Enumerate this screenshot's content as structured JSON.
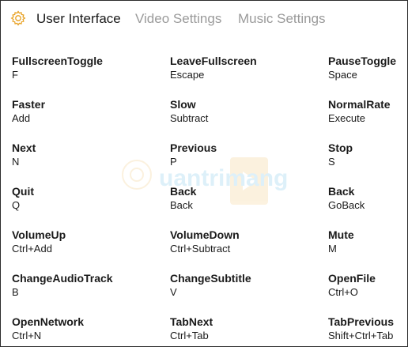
{
  "tabs": [
    {
      "label": "User Interface",
      "active": true
    },
    {
      "label": "Video Settings",
      "active": false
    },
    {
      "label": "Music Settings",
      "active": false
    }
  ],
  "colors": {
    "accent": "#e8a020",
    "text": "#1a1a1a",
    "inactive_tab": "#9a9a9a"
  },
  "icons": {
    "settings": "gear-icon"
  },
  "shortcuts": [
    [
      {
        "name": "FullscreenToggle",
        "key": "F"
      },
      {
        "name": "LeaveFullscreen",
        "key": "Escape"
      },
      {
        "name": "PauseToggle",
        "key": "Space"
      }
    ],
    [
      {
        "name": "Faster",
        "key": "Add"
      },
      {
        "name": "Slow",
        "key": "Subtract"
      },
      {
        "name": "NormalRate",
        "key": "Execute"
      }
    ],
    [
      {
        "name": "Next",
        "key": "N"
      },
      {
        "name": "Previous",
        "key": "P"
      },
      {
        "name": "Stop",
        "key": "S"
      }
    ],
    [
      {
        "name": "Quit",
        "key": "Q"
      },
      {
        "name": "Back",
        "key": "Back"
      },
      {
        "name": "Back",
        "key": "GoBack"
      }
    ],
    [
      {
        "name": "VolumeUp",
        "key": "Ctrl+Add"
      },
      {
        "name": "VolumeDown",
        "key": "Ctrl+Subtract"
      },
      {
        "name": "Mute",
        "key": "M"
      }
    ],
    [
      {
        "name": "ChangeAudioTrack",
        "key": "B"
      },
      {
        "name": "ChangeSubtitle",
        "key": "V"
      },
      {
        "name": "OpenFile",
        "key": "Ctrl+O"
      }
    ],
    [
      {
        "name": "OpenNetwork",
        "key": "Ctrl+N"
      },
      {
        "name": "TabNext",
        "key": "Ctrl+Tab"
      },
      {
        "name": "TabPrevious",
        "key": "Shift+Ctrl+Tab"
      }
    ]
  ]
}
